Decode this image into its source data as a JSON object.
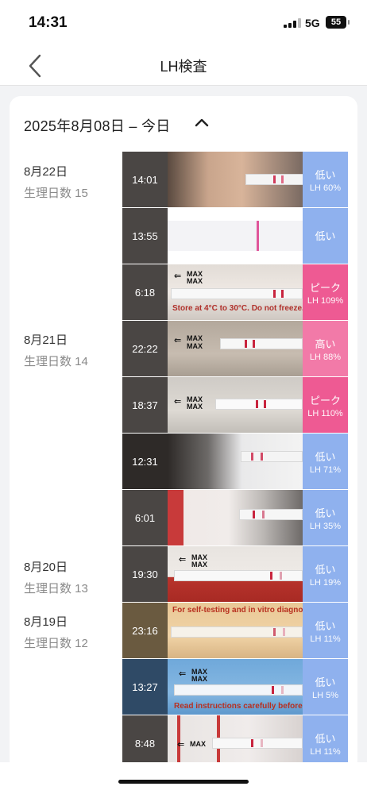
{
  "status": {
    "time": "14:31",
    "network": "5G",
    "battery": "55"
  },
  "nav": {
    "title": "LH検査",
    "back_icon": "chevron-left-icon"
  },
  "range": {
    "label": "2025年8月08日 – 今日",
    "toggle_icon": "chevron-up-icon"
  },
  "days": [
    {
      "date": "8月22日",
      "cycle": "生理日数 15"
    },
    {
      "date": "8月21日",
      "cycle": "生理日数 14"
    },
    {
      "date": "8月20日",
      "cycle": "生理日数 13"
    },
    {
      "date": "8月19日",
      "cycle": "生理日数 12"
    }
  ],
  "tests": [
    {
      "time": "14:01",
      "level": "低い",
      "lh": "LH 60%",
      "status": "low"
    },
    {
      "time": "13:55",
      "level": "低い",
      "lh": "",
      "status": "low"
    },
    {
      "time": "6:18",
      "level": "ピーク",
      "lh": "LH 109%",
      "status": "peak",
      "strip_text": "Store at 4°C to 30°C. Do not freeze."
    },
    {
      "time": "22:22",
      "level": "高い",
      "lh": "LH 88%",
      "status": "high"
    },
    {
      "time": "18:37",
      "level": "ピーク",
      "lh": "LH 110%",
      "status": "peak"
    },
    {
      "time": "12:31",
      "level": "低い",
      "lh": "LH 71%",
      "status": "low"
    },
    {
      "time": "6:01",
      "level": "低い",
      "lh": "LH 35%",
      "status": "low"
    },
    {
      "time": "19:30",
      "level": "低い",
      "lh": "LH 19%",
      "status": "low"
    },
    {
      "time": "23:16",
      "level": "低い",
      "lh": "LH 11%",
      "status": "low",
      "strip_text": "For self-testing and in vitro diagnostic use"
    },
    {
      "time": "13:27",
      "level": "低い",
      "lh": "LH 5%",
      "status": "low",
      "strip_text": "Read instructions carefully before usage"
    },
    {
      "time": "8:48",
      "level": "低い",
      "lh": "LH 11%",
      "status": "low"
    }
  ],
  "strip_labels": {
    "max": "MAX"
  },
  "colors": {
    "low": "#8fb1ee",
    "high": "#f27aa8",
    "peak": "#ee5a93",
    "time_cell": "#4a4644"
  }
}
